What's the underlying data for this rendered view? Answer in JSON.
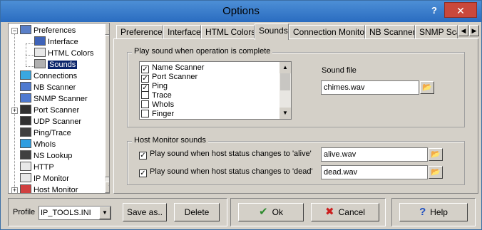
{
  "window": {
    "title": "Options",
    "help_glyph": "?",
    "close_glyph": "✕"
  },
  "tree": {
    "items": [
      {
        "label": "Preferences",
        "icon": "preferences-icon"
      },
      {
        "label": "Interface",
        "icon": "interface-icon"
      },
      {
        "label": "HTML Colors",
        "icon": "html-colors-icon"
      },
      {
        "label": "Sounds",
        "icon": "sounds-icon"
      },
      {
        "label": "Connections",
        "icon": "connections-icon"
      },
      {
        "label": "NB Scanner",
        "icon": "nb-scanner-icon"
      },
      {
        "label": "SNMP Scanner",
        "icon": "snmp-scanner-icon"
      },
      {
        "label": "Port Scanner",
        "icon": "port-scanner-icon"
      },
      {
        "label": "UDP Scanner",
        "icon": "udp-scanner-icon"
      },
      {
        "label": "Ping/Trace",
        "icon": "ping-trace-icon"
      },
      {
        "label": "WhoIs",
        "icon": "whois-icon"
      },
      {
        "label": "NS Lookup",
        "icon": "ns-lookup-icon"
      },
      {
        "label": "HTTP",
        "icon": "http-icon"
      },
      {
        "label": "IP Monitor",
        "icon": "ip-monitor-icon"
      },
      {
        "label": "Host Monitor",
        "icon": "host-monitor-icon"
      }
    ],
    "expand_glyph": "+",
    "collapse_glyph": "−",
    "scroll_up": "▲",
    "scroll_down": "▼"
  },
  "tabs": [
    {
      "label": "Preferences"
    },
    {
      "label": "Interface"
    },
    {
      "label": "HTML Colors"
    },
    {
      "label": "Sounds"
    },
    {
      "label": "Connection Monitor"
    },
    {
      "label": "NB Scanner"
    },
    {
      "label": "SNMP Sca"
    }
  ],
  "tab_scroll": {
    "left": "◀",
    "right": "▶"
  },
  "sounds": {
    "operation_group_label": "Play sound when operation is complete",
    "operations": [
      {
        "label": "Name Scanner",
        "checked": true
      },
      {
        "label": "Port Scanner",
        "checked": true
      },
      {
        "label": "Ping",
        "checked": true
      },
      {
        "label": "Trace",
        "checked": false
      },
      {
        "label": "WhoIs",
        "checked": false
      },
      {
        "label": "Finger",
        "checked": false
      }
    ],
    "check_glyph": "✓",
    "sound_file_label": "Sound file",
    "sound_file_value": "chimes.wav",
    "host_group_label": "Host Monitor sounds",
    "alive_label": "Play sound when host status changes to 'alive'",
    "alive_checked": true,
    "alive_file": "alive.wav",
    "dead_label": "Play sound when host status changes to 'dead'",
    "dead_checked": true,
    "dead_file": "dead.wav",
    "browse_glyph": "📂"
  },
  "footer": {
    "profile_label": "Profile",
    "profile_value": "IP_TOOLS.INI",
    "save_as_label": "Save as..",
    "delete_label": "Delete",
    "ok_label": "Ok",
    "ok_glyph": "✔",
    "cancel_label": "Cancel",
    "cancel_glyph": "✖",
    "help_label": "Help",
    "help_glyph": "?",
    "ok_color": "#2e8b2e",
    "cancel_color": "#cc1f1f",
    "help_color": "#1f4fbf"
  }
}
